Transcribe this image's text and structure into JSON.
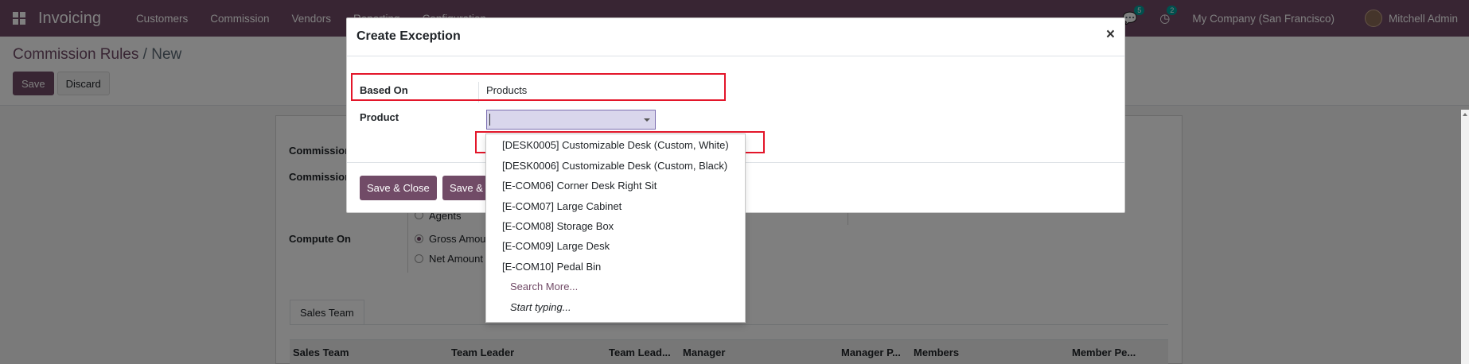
{
  "navbar": {
    "app_name": "Invoicing",
    "menu": [
      "Customers",
      "Commission",
      "Vendors",
      "Reporting",
      "Configuration"
    ],
    "chat_count": "5",
    "activity_count": "2",
    "company": "My Company (San Francisco)",
    "user": "Mitchell Admin"
  },
  "control_panel": {
    "breadcrumb_root": "Commission Rules",
    "breadcrumb_separator": "/",
    "breadcrumb_current": "New",
    "save_label": "Save",
    "discard_label": "Discard"
  },
  "form": {
    "label_1": "Commission",
    "label_2": "Commission",
    "compute_on_label": "Compute On",
    "agents_label": "Agents",
    "gross_amount_label": "Gross Amou",
    "net_amount_label": "Net Amount",
    "tab_label": "Sales Team",
    "table_headers": [
      "Sales Team",
      "Team Leader",
      "Team Lead...",
      "Manager",
      "Manager P...",
      "Members",
      "Member Pe..."
    ]
  },
  "modal": {
    "title": "Create Exception",
    "close_symbol": "×",
    "based_on_label": "Based On",
    "based_on_value": "Products",
    "product_label": "Product",
    "product_value": "",
    "save_close_label": "Save & Close",
    "save_new_label": "Save &"
  },
  "dropdown": {
    "items": [
      "[DESK0005] Customizable Desk (Custom, White)",
      "[DESK0006] Customizable Desk (Custom, Black)",
      "[E-COM06] Corner Desk Right Sit",
      "[E-COM07] Large Cabinet",
      "[E-COM08] Storage Box",
      "[E-COM09] Large Desk",
      "[E-COM10] Pedal Bin"
    ],
    "search_more": "Search More...",
    "start_typing": "Start typing..."
  },
  "colors": {
    "brand": "#714b67",
    "highlight": "#e3162a",
    "badge": "#00a09d"
  }
}
